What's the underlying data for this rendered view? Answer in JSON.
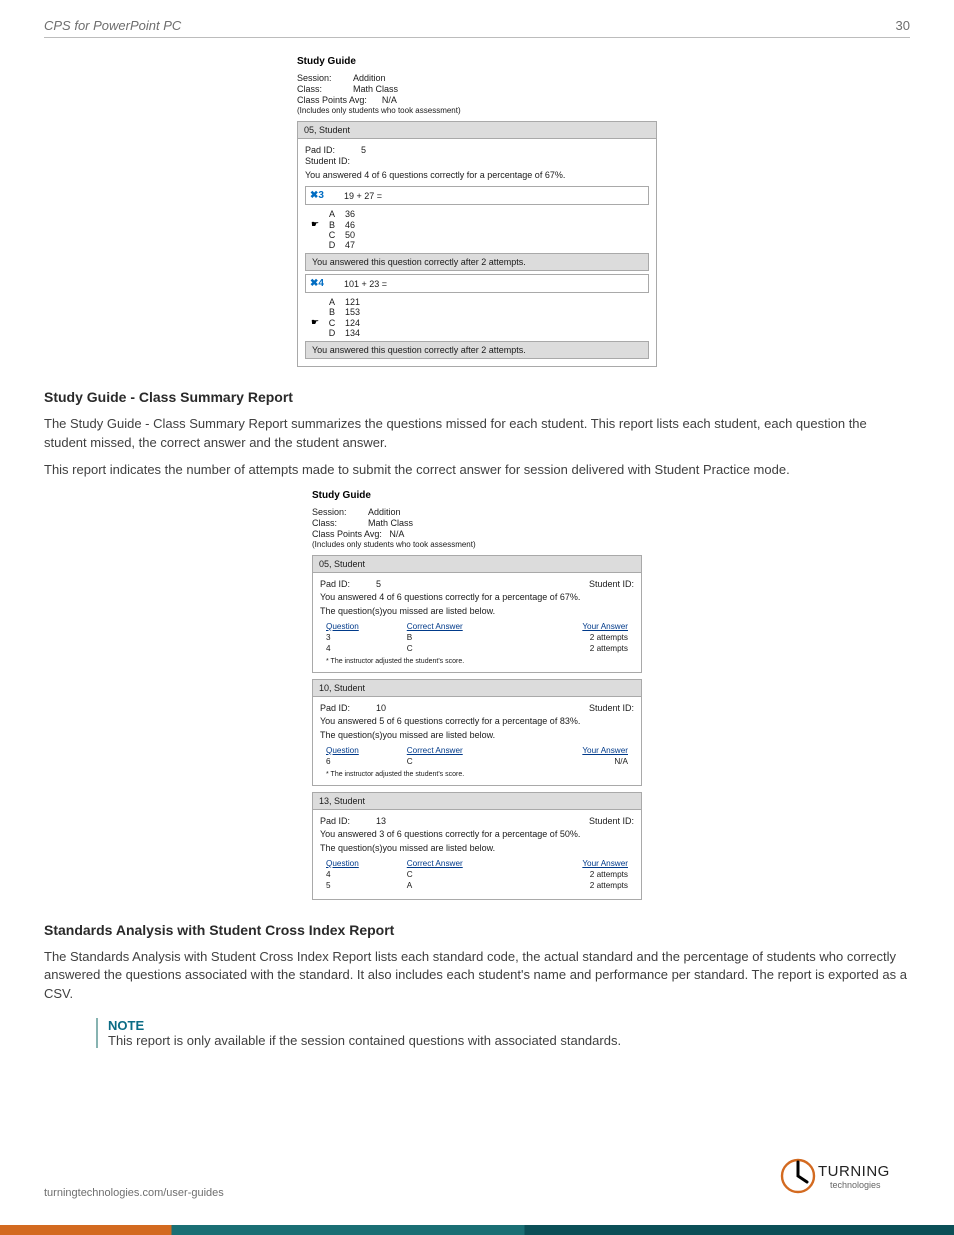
{
  "header": {
    "title": "CPS for PowerPoint PC",
    "page_number": "30"
  },
  "section1": {
    "shot_title": "Study Guide",
    "meta": {
      "session_label": "Session:",
      "session_value": "Addition",
      "class_label": "Class:",
      "class_value": "Math Class",
      "avg_label": "Class Points Avg:",
      "avg_value": "N/A",
      "note": "(Includes only students who took assessment)"
    },
    "student_bar": "05, Student",
    "padid_label": "Pad ID:",
    "padid_value": "5",
    "studentid_label": "Student ID:",
    "answered_line": "You answered 4 of 6 questions correctly for a percentage of 67%.",
    "q3": {
      "mark": "✖3",
      "text": "19 + 27 =",
      "options": [
        {
          "letter": "A",
          "val": "36",
          "ptr": false
        },
        {
          "letter": "B",
          "val": "46",
          "ptr": true
        },
        {
          "letter": "C",
          "val": "50",
          "ptr": false
        },
        {
          "letter": "D",
          "val": "47",
          "ptr": false
        }
      ],
      "result": "You answered this question correctly after 2 attempts."
    },
    "q4": {
      "mark": "✖4",
      "text": "101 + 23 =",
      "options": [
        {
          "letter": "A",
          "val": "121",
          "ptr": false
        },
        {
          "letter": "B",
          "val": "153",
          "ptr": false
        },
        {
          "letter": "C",
          "val": "124",
          "ptr": true
        },
        {
          "letter": "D",
          "val": "134",
          "ptr": false
        }
      ],
      "result": "You answered this question correctly after 2 attempts."
    }
  },
  "sectionA": {
    "heading": "Study Guide - Class Summary Report",
    "para1": "The Study Guide - Class Summary Report summarizes the questions missed for each student. This report lists each student, each question the student missed, the correct answer and the student answer.",
    "para2": "This report indicates the number of attempts made to submit the correct answer for session delivered with Student Practice mode."
  },
  "section2": {
    "shot_title": "Study Guide",
    "meta": {
      "session_label": "Session:",
      "session_value": "Addition",
      "class_label": "Class:",
      "class_value": "Math Class",
      "avg_label": "Class Points Avg:",
      "avg_value": "N/A",
      "note": "(Includes only students who took assessment)"
    },
    "students": [
      {
        "bar": "05, Student",
        "padid": "5",
        "sid_label": "Student ID:",
        "answered": "You answered 4 of 6 questions correctly for a percentage of 67%.",
        "missed_line": "The question(s)you missed are listed below.",
        "cols": {
          "q": "Question",
          "ca": "Correct Answer",
          "ya": "Your Answer"
        },
        "rows": [
          {
            "q": "3",
            "ca": "B",
            "ya": "2 attempts"
          },
          {
            "q": "4",
            "ca": "C",
            "ya": "2 attempts"
          }
        ],
        "footnote": "* The instructor adjusted the student's score."
      },
      {
        "bar": "10, Student",
        "padid": "10",
        "sid_label": "Student ID:",
        "answered": "You answered 5 of 6 questions correctly for a percentage of 83%.",
        "missed_line": "The question(s)you missed are listed below.",
        "cols": {
          "q": "Question",
          "ca": "Correct Answer",
          "ya": "Your Answer"
        },
        "rows": [
          {
            "q": "6",
            "ca": "C",
            "ya": "N/A"
          }
        ],
        "footnote": "* The instructor adjusted the student's score."
      },
      {
        "bar": "13, Student",
        "padid": "13",
        "sid_label": "Student ID:",
        "answered": "You answered 3 of 6 questions correctly for a percentage of 50%.",
        "missed_line": "The question(s)you missed are listed below.",
        "cols": {
          "q": "Question",
          "ca": "Correct Answer",
          "ya": "Your Answer"
        },
        "rows": [
          {
            "q": "4",
            "ca": "C",
            "ya": "2 attempts"
          },
          {
            "q": "5",
            "ca": "A",
            "ya": "2 attempts"
          }
        ],
        "footnote": ""
      }
    ]
  },
  "sectionB": {
    "heading": "Standards Analysis with Student Cross Index Report",
    "para1": "The Standards Analysis with Student Cross Index Report lists each standard code, the actual standard and the percentage of students who correctly answered the questions associated with the standard. It also includes each student's name and performance per standard. The report is exported as a CSV."
  },
  "note": {
    "head": "NOTE",
    "body": "This report is only available if the session contained questions with associated standards."
  },
  "footer": {
    "url": "turningtechnologies.com/user-guides",
    "logo_top": "TURNING",
    "logo_sub": "technologies"
  }
}
